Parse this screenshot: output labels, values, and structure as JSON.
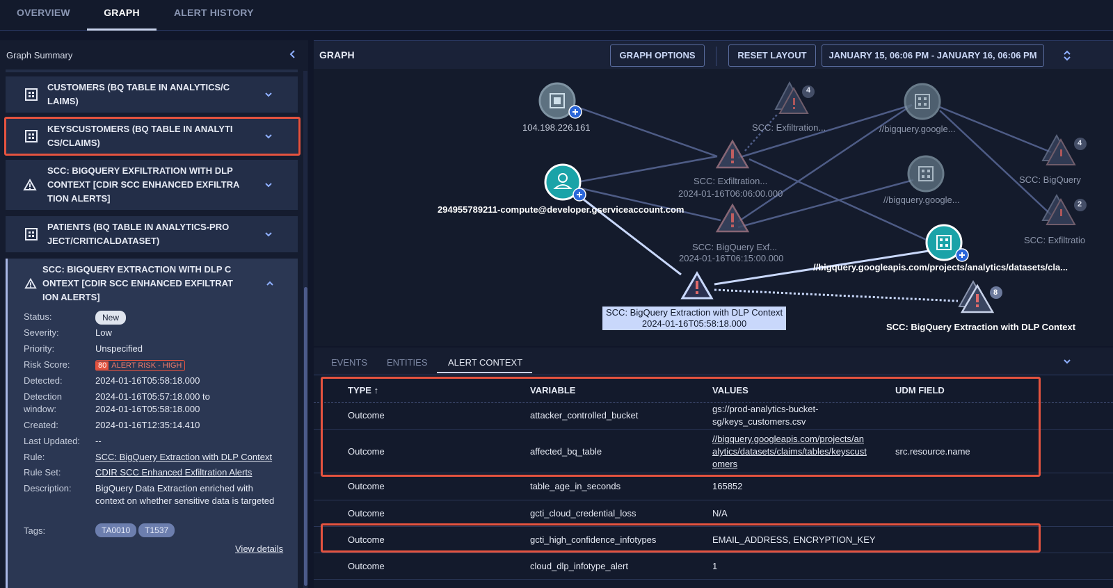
{
  "top_tabs": [
    {
      "label": "OVERVIEW"
    },
    {
      "label": "GRAPH"
    },
    {
      "label": "ALERT HISTORY"
    }
  ],
  "summary": {
    "title": "Graph Summary",
    "cards": [
      {
        "title": "CUSTOMERS (BQ TABLE IN ANALYTICS/C LAIMS)",
        "icon": "table-icon"
      },
      {
        "title": "KEYSCUSTOMERS (BQ TABLE IN ANALYTI CS/CLAIMS)",
        "icon": "table-icon"
      },
      {
        "title": "SCC: BIGQUERY EXFILTRATION WITH DLP CONTEXT [CDIR SCC ENHANCED EXFILTRA TION ALERTS]",
        "icon": "alert-icon"
      },
      {
        "title": "PATIENTS (BQ TABLE IN ANALYTICS-PRO JECT/CRITICALDATASET)",
        "icon": "table-icon"
      }
    ],
    "expanded": {
      "title": "SCC: BIGQUERY EXTRACTION WITH DLP C ONTEXT [CDIR SCC ENHANCED EXFILTRAT ION ALERTS]",
      "status_label": "Status:",
      "status": "New",
      "severity_label": "Severity:",
      "severity": "Low",
      "priority_label": "Priority:",
      "priority": "Unspecified",
      "risk_label": "Risk Score:",
      "risk_score": "80",
      "risk_text": "ALERT RISK - HIGH",
      "detected_label": "Detected:",
      "detected": "2024-01-16T05:58:18.000",
      "window_label_1": "Detection",
      "window_label_2": "window:",
      "window_1": "2024-01-16T05:57:18.000 to",
      "window_2": "2024-01-16T05:58:18.000",
      "created_label": "Created:",
      "created": "2024-01-16T12:35:14.410",
      "updated_label": "Last Updated:",
      "updated": "--",
      "rule_label": "Rule:",
      "rule": "SCC: BigQuery Extraction with DLP Context",
      "ruleset_label": "Rule Set:",
      "ruleset": "CDIR SCC Enhanced Exfiltration Alerts",
      "desc_label": "Description:",
      "description": "BigQuery Data Extraction enriched with context on whether sensitive data is targeted",
      "tags_label": "Tags:",
      "tags": [
        "TA0010",
        "T1537"
      ],
      "view_details": "View details"
    }
  },
  "graph": {
    "title": "GRAPH",
    "options_label": "GRAPH OPTIONS",
    "reset_label": "RESET LAYOUT",
    "date_range": "JANUARY 15, 06:06 PM - JANUARY 16, 06:06 PM",
    "nodes": {
      "ip": "104.198.226.161",
      "exfil_group_label": "SCC: Exfiltration...",
      "exfil_group_count": "4",
      "bq_top_label": "//bigquery.google...",
      "scc_bigquery_right_label": "SCC: BigQuery",
      "scc_bigquery_right_count": "4",
      "exfil_label": "SCC: Exfiltration...",
      "exfil_time": "2024-01-16T06:06:00.000",
      "bq_mid_label": "//bigquery.google...",
      "exfil_right_label": "SCC: Exfiltratio",
      "exfil_right_count": "2",
      "account_label": "294955789211-compute@developer.gserviceaccount.com",
      "bq_exf_label": "SCC: BigQuery Exf...",
      "bq_exf_time": "2024-01-16T06:15:00.000",
      "bq_full_label": "//bigquery.googleapis.com/projects/analytics/datasets/cla...",
      "selected_label": "SCC: BigQuery Extraction with DLP Context",
      "selected_time": "2024-01-16T05:58:18.000",
      "extraction_group_label": "SCC: BigQuery Extraction with DLP Context",
      "extraction_group_count": "8"
    }
  },
  "bottom_tabs": [
    {
      "label": "EVENTS"
    },
    {
      "label": "ENTITIES"
    },
    {
      "label": "ALERT CONTEXT"
    }
  ],
  "table": {
    "headers": [
      "TYPE ↑",
      "VARIABLE",
      "VALUES",
      "UDM FIELD"
    ],
    "rows": [
      {
        "type": "Outcome",
        "variable": "attacker_controlled_bucket",
        "value_1": "gs://prod-analytics-bucket-",
        "value_2": "sg/keys_customers.csv",
        "value_3": "",
        "udm": ""
      },
      {
        "type": "Outcome",
        "variable": "affected_bq_table",
        "value_1": "//bigquery.googleapis.com/projects/an",
        "value_2": "alytics/datasets/claims/tables/keyscust",
        "value_3": "omers",
        "udm": "src.resource.name"
      },
      {
        "type": "Outcome",
        "variable": "table_age_in_seconds",
        "value_1": "165852",
        "value_2": "",
        "value_3": "",
        "udm": ""
      },
      {
        "type": "Outcome",
        "variable": "gcti_cloud_credential_loss",
        "value_1": "N/A",
        "value_2": "",
        "value_3": "",
        "udm": ""
      },
      {
        "type": "Outcome",
        "variable": "gcti_high_confidence_infotypes",
        "value_1": "EMAIL_ADDRESS, ENCRYPTION_KEY",
        "value_2": "",
        "value_3": "",
        "udm": ""
      },
      {
        "type": "Outcome",
        "variable": "cloud_dlp_infotype_alert",
        "value_1": "1",
        "value_2": "",
        "value_3": "",
        "udm": ""
      }
    ]
  },
  "colors": {
    "highlight": "#e5533f",
    "accent": "#c9d8fb",
    "node_teal": "#1aa3a8",
    "node_gray": "#5d7180",
    "alert_red": "#e06a6a"
  }
}
